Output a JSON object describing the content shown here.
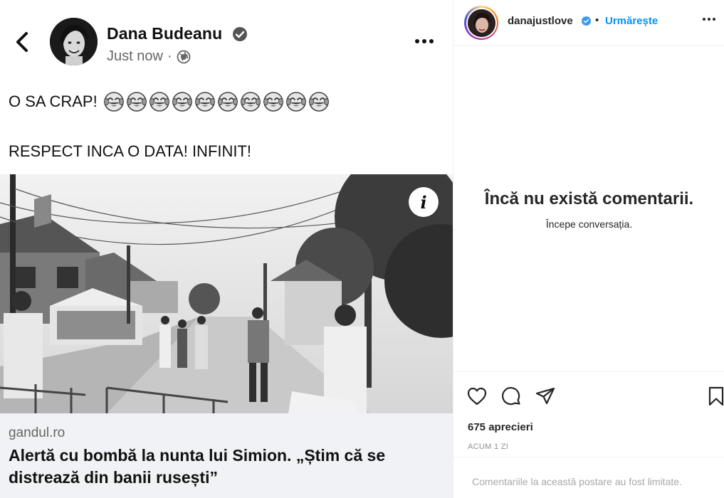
{
  "post": {
    "author": "Dana Budeanu",
    "time": "Just now",
    "separator": "·",
    "line1": "O SA CRAP!",
    "line2": "RESPECT INCA O DATA! INFINIT!",
    "emoji_count": 10
  },
  "link": {
    "domain": "gandul.ro",
    "title": "Alertă cu bombă la nunta lui Simion. „Știm că se distrează din banii rusești”"
  },
  "instagram": {
    "username": "danajustlove",
    "dot": "•",
    "follow_label": "Urmărește",
    "no_comments": "Încă nu există comentarii.",
    "start_conversation": "Începe conversația.",
    "likes": "675 aprecieri",
    "time_ago": "ACUM 1 ZI",
    "comments_limited": "Comentariile la această postare au fost limitate."
  },
  "colors": {
    "follow_blue": "#0095f6",
    "verified_blue": "#3897f0",
    "link_card_bg": "#f0f2f5"
  },
  "icons": [
    "back-arrow-icon",
    "globe-icon",
    "verified-icon",
    "more-icon",
    "info-icon",
    "heart-icon",
    "comment-icon",
    "share-icon",
    "bookmark-icon",
    "laughing-emoji-icon"
  ]
}
